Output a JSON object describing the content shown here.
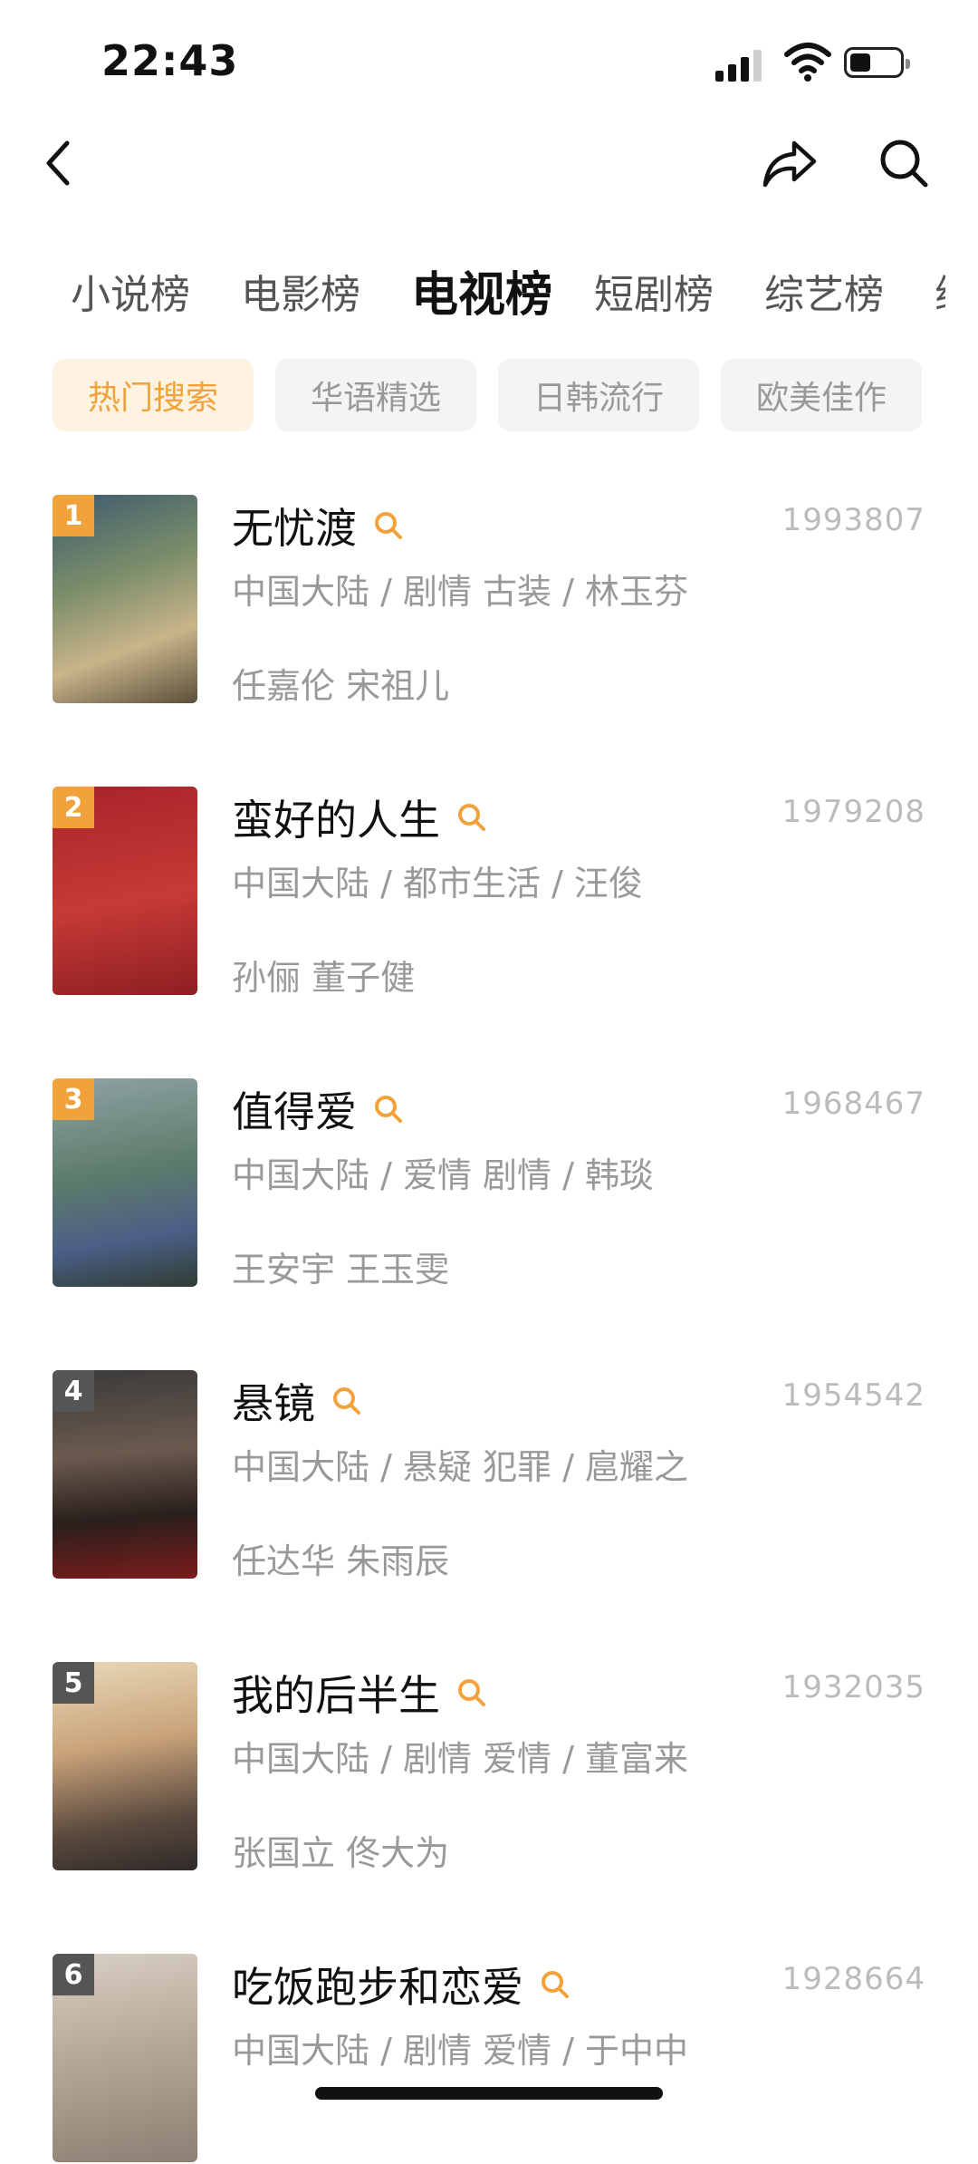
{
  "status_bar": {
    "time": "22:43"
  },
  "nav": {
    "back_icon": "chevron-left-icon",
    "share_icon": "share-arrow-icon",
    "search_icon": "search-icon"
  },
  "category_tabs": [
    "小说榜",
    "电影榜",
    "电视榜",
    "短剧榜",
    "综艺榜"
  ],
  "active_category": "电视榜",
  "filter_chips": [
    "热门搜索",
    "华语精选",
    "日韩流行",
    "欧美佳作"
  ],
  "active_chip": "热门搜索",
  "colors": {
    "accent": "#f2a23b",
    "chip_active_bg": "#fdf3e0",
    "rank_other": "#555555"
  },
  "items": [
    {
      "rank": "1",
      "title": "无忧渡",
      "heat": "1993807",
      "meta": "中国大陆 / 剧情 古装 / 林玉芬",
      "cast": "任嘉伦 宋祖儿"
    },
    {
      "rank": "2",
      "title": "蛮好的人生",
      "heat": "1979208",
      "meta": "中国大陆 / 都市生活 / 汪俊",
      "cast": "孙俪 董子健"
    },
    {
      "rank": "3",
      "title": "值得爱",
      "heat": "1968467",
      "meta": "中国大陆 / 爱情 剧情 / 韩琰",
      "cast": "王安宇 王玉雯"
    },
    {
      "rank": "4",
      "title": "悬镜",
      "heat": "1954542",
      "meta": "中国大陆 / 悬疑 犯罪 / 扈耀之",
      "cast": "任达华 朱雨辰"
    },
    {
      "rank": "5",
      "title": "我的后半生",
      "heat": "1932035",
      "meta": "中国大陆 / 剧情 爱情 / 董富来",
      "cast": "张国立 佟大为"
    },
    {
      "rank": "6",
      "title": "吃饭跑步和恋爱",
      "heat": "1928664",
      "meta": "中国大陆 / 剧情 爱情 / 于中中",
      "cast": ""
    }
  ]
}
